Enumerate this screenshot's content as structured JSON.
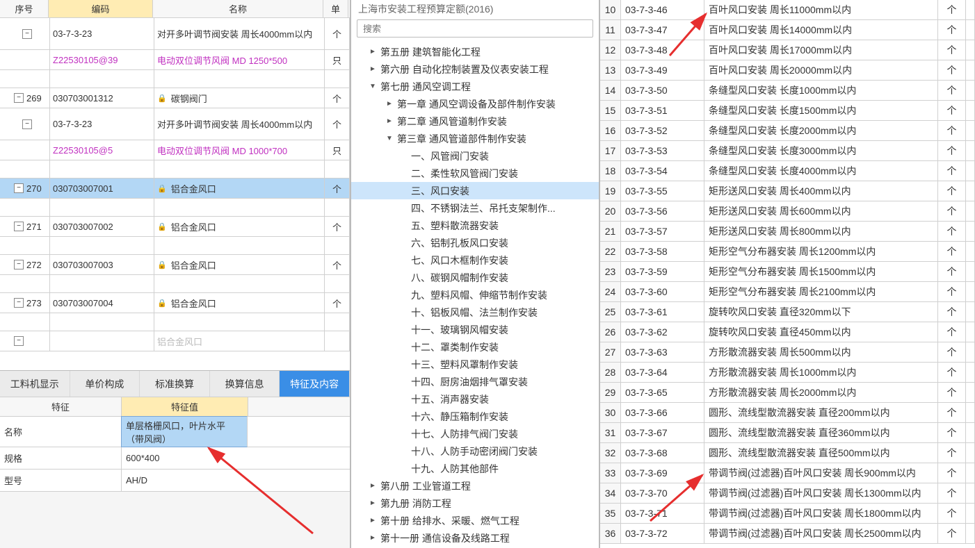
{
  "left_grid": {
    "headers": {
      "seq": "序号",
      "code": "编码",
      "name": "名称",
      "unit": "单"
    },
    "rows": [
      {
        "exp": "-",
        "seq": "",
        "code": "03-7-3-23",
        "name": "对开多叶调节阀安装 周长4000mm以内",
        "unit": "个",
        "h": 2,
        "indent": 1
      },
      {
        "seq": "",
        "code": "Z22530105@39",
        "name": "电动双位调节风阀 MD 1250*500",
        "unit": "只",
        "magenta": true,
        "indent": 2
      },
      {
        "spacer": true
      },
      {
        "exp": "-",
        "seq": "269",
        "code": "030703001312",
        "name": "碳钢阀门",
        "unit": "个",
        "lock": true,
        "indent": 0
      },
      {
        "exp": "-",
        "seq": "",
        "code": "03-7-3-23",
        "name": "对开多叶调节阀安装 周长4000mm以内",
        "unit": "个",
        "h": 2,
        "indent": 1
      },
      {
        "seq": "",
        "code": "Z22530105@5",
        "name": "电动双位调节风阀 MD 1000*700",
        "unit": "只",
        "magenta": true,
        "indent": 2
      },
      {
        "spacer": true
      },
      {
        "exp": "-",
        "seq": "270",
        "code": "030703007001",
        "name": "铝合金风口",
        "unit": "个",
        "lock": true,
        "selected": true,
        "indent": 0
      },
      {
        "spacer": true
      },
      {
        "exp": "-",
        "seq": "271",
        "code": "030703007002",
        "name": "铝合金风口",
        "unit": "个",
        "lock": true,
        "indent": 0
      },
      {
        "spacer": true
      },
      {
        "exp": "-",
        "seq": "272",
        "code": "030703007003",
        "name": "铝合金风口",
        "unit": "个",
        "lock": true,
        "indent": 0
      },
      {
        "spacer": true
      },
      {
        "exp": "-",
        "seq": "273",
        "code": "030703007004",
        "name": "铝合金风口",
        "unit": "个",
        "lock": true,
        "indent": 0
      },
      {
        "spacer": true
      },
      {
        "exp": "-",
        "seq": "",
        "code": "",
        "name": "铝合金风口",
        "unit": "",
        "indent": 0,
        "faded": true
      }
    ]
  },
  "lower": {
    "tabs": [
      "工料机显示",
      "单价构成",
      "标准换算",
      "换算信息",
      "特征及内容"
    ],
    "active": 4,
    "prop_headers": {
      "key": "特征",
      "val": "特征值"
    },
    "props": [
      {
        "k": "名称",
        "v": "单层格栅风口，叶片水平（带风阀）",
        "sel": true,
        "h": 2
      },
      {
        "k": "规格",
        "v": "600*400"
      },
      {
        "k": "型号",
        "v": "AH/D"
      }
    ]
  },
  "mid": {
    "title": "上海市安装工程预算定额(2016)",
    "search_ph": "搜索",
    "tree": [
      {
        "t": "第五册 建筑智能化工程",
        "lvl": 1,
        "icon": "►"
      },
      {
        "t": "第六册 自动化控制装置及仪表安装工程",
        "lvl": 1,
        "icon": "►"
      },
      {
        "t": "第七册 通风空调工程",
        "lvl": 1,
        "icon": "▼"
      },
      {
        "t": "第一章 通风空调设备及部件制作安装",
        "lvl": 2,
        "icon": "►"
      },
      {
        "t": "第二章 通风管道制作安装",
        "lvl": 2,
        "icon": "►"
      },
      {
        "t": "第三章 通风管道部件制作安装",
        "lvl": 2,
        "icon": "▼"
      },
      {
        "t": "一、风管阀门安装",
        "lvl": 3
      },
      {
        "t": "二、柔性软风管阀门安装",
        "lvl": 3
      },
      {
        "t": "三、风口安装",
        "lvl": 3,
        "sel": true
      },
      {
        "t": "四、不锈钢法兰、吊托支架制作...",
        "lvl": 3
      },
      {
        "t": "五、塑料散流器安装",
        "lvl": 3
      },
      {
        "t": "六、铝制孔板风口安装",
        "lvl": 3
      },
      {
        "t": "七、风口木框制作安装",
        "lvl": 3
      },
      {
        "t": "八、碳钢风帽制作安装",
        "lvl": 3
      },
      {
        "t": "九、塑料风帽、伸缩节制作安装",
        "lvl": 3
      },
      {
        "t": "十、铝板风帽、法兰制作安装",
        "lvl": 3
      },
      {
        "t": "十一、玻璃钢风帽安装",
        "lvl": 3
      },
      {
        "t": "十二、罩类制作安装",
        "lvl": 3
      },
      {
        "t": "十三、塑料风罩制作安装",
        "lvl": 3
      },
      {
        "t": "十四、厨房油烟排气罩安装",
        "lvl": 3
      },
      {
        "t": "十五、消声器安装",
        "lvl": 3
      },
      {
        "t": "十六、静压箱制作安装",
        "lvl": 3
      },
      {
        "t": "十七、人防排气阀门安装",
        "lvl": 3
      },
      {
        "t": "十八、人防手动密闭阀门安装",
        "lvl": 3
      },
      {
        "t": "十九、人防其他部件",
        "lvl": 3
      },
      {
        "t": "第八册 工业管道工程",
        "lvl": 1,
        "icon": "►"
      },
      {
        "t": "第九册 消防工程",
        "lvl": 1,
        "icon": "►"
      },
      {
        "t": "第十册 给排水、采暖、燃气工程",
        "lvl": 1,
        "icon": "►"
      },
      {
        "t": "第十一册 通信设备及线路工程",
        "lvl": 1,
        "icon": "►"
      }
    ]
  },
  "right": {
    "rows": [
      {
        "n": 10,
        "code": "03-7-3-46",
        "name": "百叶风口安装 周长11000mm以内",
        "unit": "个"
      },
      {
        "n": 11,
        "code": "03-7-3-47",
        "name": "百叶风口安装 周长14000mm以内",
        "unit": "个"
      },
      {
        "n": 12,
        "code": "03-7-3-48",
        "name": "百叶风口安装 周长17000mm以内",
        "unit": "个"
      },
      {
        "n": 13,
        "code": "03-7-3-49",
        "name": "百叶风口安装 周长20000mm以内",
        "unit": "个"
      },
      {
        "n": 14,
        "code": "03-7-3-50",
        "name": "条缝型风口安装 长度1000mm以内",
        "unit": "个"
      },
      {
        "n": 15,
        "code": "03-7-3-51",
        "name": "条缝型风口安装 长度1500mm以内",
        "unit": "个"
      },
      {
        "n": 16,
        "code": "03-7-3-52",
        "name": "条缝型风口安装 长度2000mm以内",
        "unit": "个"
      },
      {
        "n": 17,
        "code": "03-7-3-53",
        "name": "条缝型风口安装 长度3000mm以内",
        "unit": "个"
      },
      {
        "n": 18,
        "code": "03-7-3-54",
        "name": "条缝型风口安装 长度4000mm以内",
        "unit": "个"
      },
      {
        "n": 19,
        "code": "03-7-3-55",
        "name": "矩形送风口安装 周长400mm以内",
        "unit": "个"
      },
      {
        "n": 20,
        "code": "03-7-3-56",
        "name": "矩形送风口安装 周长600mm以内",
        "unit": "个"
      },
      {
        "n": 21,
        "code": "03-7-3-57",
        "name": "矩形送风口安装 周长800mm以内",
        "unit": "个"
      },
      {
        "n": 22,
        "code": "03-7-3-58",
        "name": "矩形空气分布器安装 周长1200mm以内",
        "unit": "个"
      },
      {
        "n": 23,
        "code": "03-7-3-59",
        "name": "矩形空气分布器安装 周长1500mm以内",
        "unit": "个"
      },
      {
        "n": 24,
        "code": "03-7-3-60",
        "name": "矩形空气分布器安装 周长2100mm以内",
        "unit": "个"
      },
      {
        "n": 25,
        "code": "03-7-3-61",
        "name": "旋转吹风口安装 直径320mm以下",
        "unit": "个"
      },
      {
        "n": 26,
        "code": "03-7-3-62",
        "name": "旋转吹风口安装 直径450mm以内",
        "unit": "个"
      },
      {
        "n": 27,
        "code": "03-7-3-63",
        "name": "方形散流器安装 周长500mm以内",
        "unit": "个"
      },
      {
        "n": 28,
        "code": "03-7-3-64",
        "name": "方形散流器安装 周长1000mm以内",
        "unit": "个"
      },
      {
        "n": 29,
        "code": "03-7-3-65",
        "name": "方形散流器安装 周长2000mm以内",
        "unit": "个"
      },
      {
        "n": 30,
        "code": "03-7-3-66",
        "name": "圆形、流线型散流器安装 直径200mm以内",
        "unit": "个"
      },
      {
        "n": 31,
        "code": "03-7-3-67",
        "name": "圆形、流线型散流器安装 直径360mm以内",
        "unit": "个"
      },
      {
        "n": 32,
        "code": "03-7-3-68",
        "name": "圆形、流线型散流器安装 直径500mm以内",
        "unit": "个"
      },
      {
        "n": 33,
        "code": "03-7-3-69",
        "name": "带调节阀(过滤器)百叶风口安装 周长900mm以内",
        "unit": "个"
      },
      {
        "n": 34,
        "code": "03-7-3-70",
        "name": "带调节阀(过滤器)百叶风口安装 周长1300mm以内",
        "unit": "个"
      },
      {
        "n": 35,
        "code": "03-7-3-71",
        "name": "带调节阀(过滤器)百叶风口安装 周长1800mm以内",
        "unit": "个"
      },
      {
        "n": 36,
        "code": "03-7-3-72",
        "name": "带调节阀(过滤器)百叶风口安装 周长2500mm以内",
        "unit": "个"
      }
    ]
  }
}
